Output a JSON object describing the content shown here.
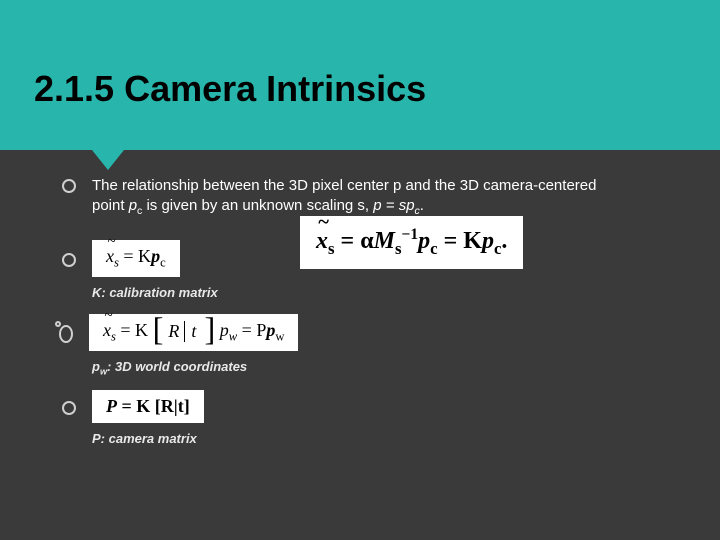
{
  "title": "2.1.5 Camera Intrinsics",
  "intro": {
    "line1": "The relationship between the 3D pixel center p and the 3D camera-centered",
    "line2_a": "point ",
    "line2_pc": "p",
    "line2_pc_sub": "c",
    "line2_b": " is given by an unknown scaling s, ",
    "line2_eq": "p = sp",
    "line2_eq_sub": "c",
    "line2_end": "."
  },
  "eq_right": {
    "xs": "x",
    "xs_sub": "s",
    "eq": " = α",
    "M": "M",
    "M_sub": "s",
    "M_sup": "−1",
    "p": "p",
    "p_sub": "c",
    "eq2": " = K",
    "p2": "p",
    "p2_sub": "c",
    "end": "."
  },
  "eq2": {
    "xs": "x",
    "xs_sub": "s",
    "eq": " = K",
    "p": "p",
    "p_sub": "c"
  },
  "caption_K": "K: calibration matrix",
  "eq3": {
    "xs": "x",
    "xs_sub": "s",
    "pre": " = K ",
    "R": "R",
    "t": "t",
    "p": " p",
    "p_sub": "w",
    "eq2": " = P",
    "p2": "p",
    "p2_sub": "w"
  },
  "caption_pw_a": "p",
  "caption_pw_sub": "w",
  "caption_pw_b": ": 3D world coordinates",
  "eq4": {
    "P": "P",
    "eq": " = K [R|t]"
  },
  "caption_P": "P: camera matrix"
}
